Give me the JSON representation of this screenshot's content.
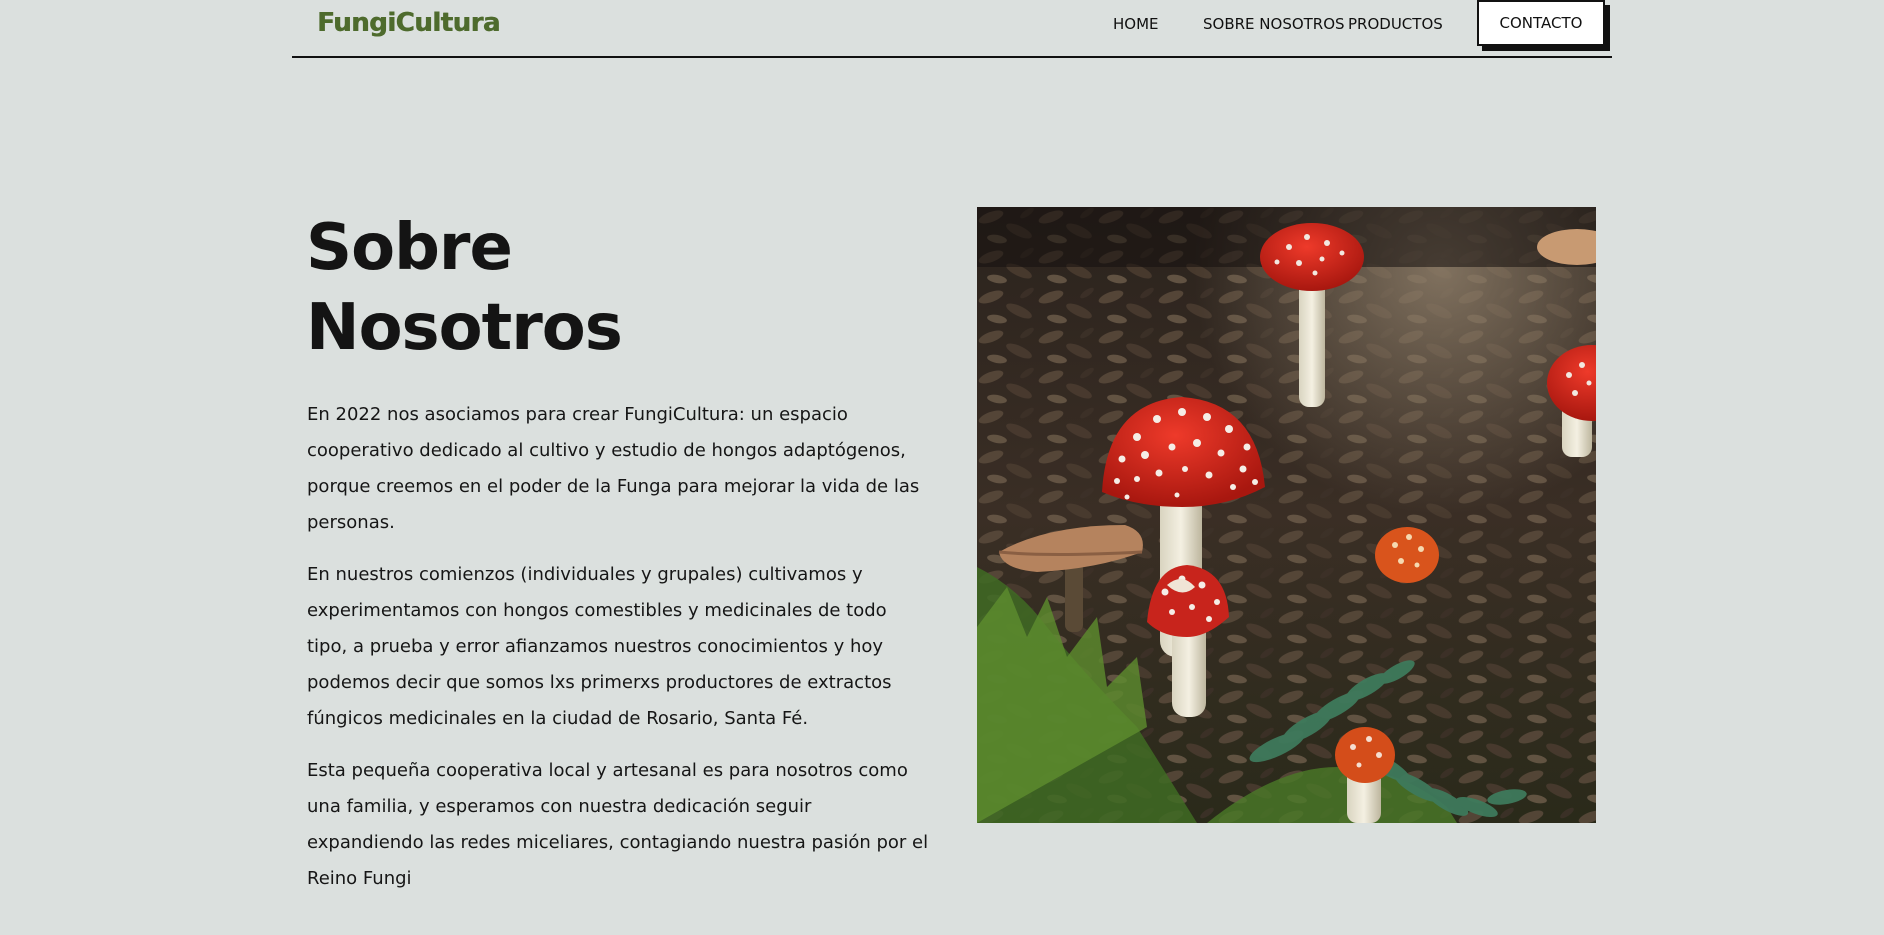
{
  "header": {
    "logo": "FungiCultura",
    "nav": {
      "home": "HOME",
      "about": "SOBRE NOSOTROS",
      "products": "PRODUCTOS",
      "contact": "CONTACTO"
    }
  },
  "main": {
    "title_line1": "Sobre",
    "title_line2": "Nosotros",
    "paragraphs": [
      "En 2022 nos asociamos para crear FungiCultura: un espacio cooperativo dedicado al cultivo y estudio de hongos adaptógenos, porque creemos en el poder de la Funga para mejorar la vida de las personas.",
      "En nuestros comienzos (individuales y grupales) cultivamos y experimentamos con hongos comestibles y medicinales de todo tipo, a prueba y error afianzamos nuestros conocimientos y hoy podemos decir que somos lxs primerxs productores de extractos fúngicos medicinales en la ciudad de Rosario, Santa Fé.",
      "Esta pequeña cooperativa local y artesanal es para nosotros como una familia, y esperamos con nuestra dedicación seguir expandiendo las redes miceliares, contagiando nuestra pasión por el Reino Fungi"
    ]
  },
  "colors": {
    "background": "#dbe0de",
    "logo": "#4e6b2d",
    "text": "#111111",
    "mushroom_cap": "#d2261a"
  }
}
